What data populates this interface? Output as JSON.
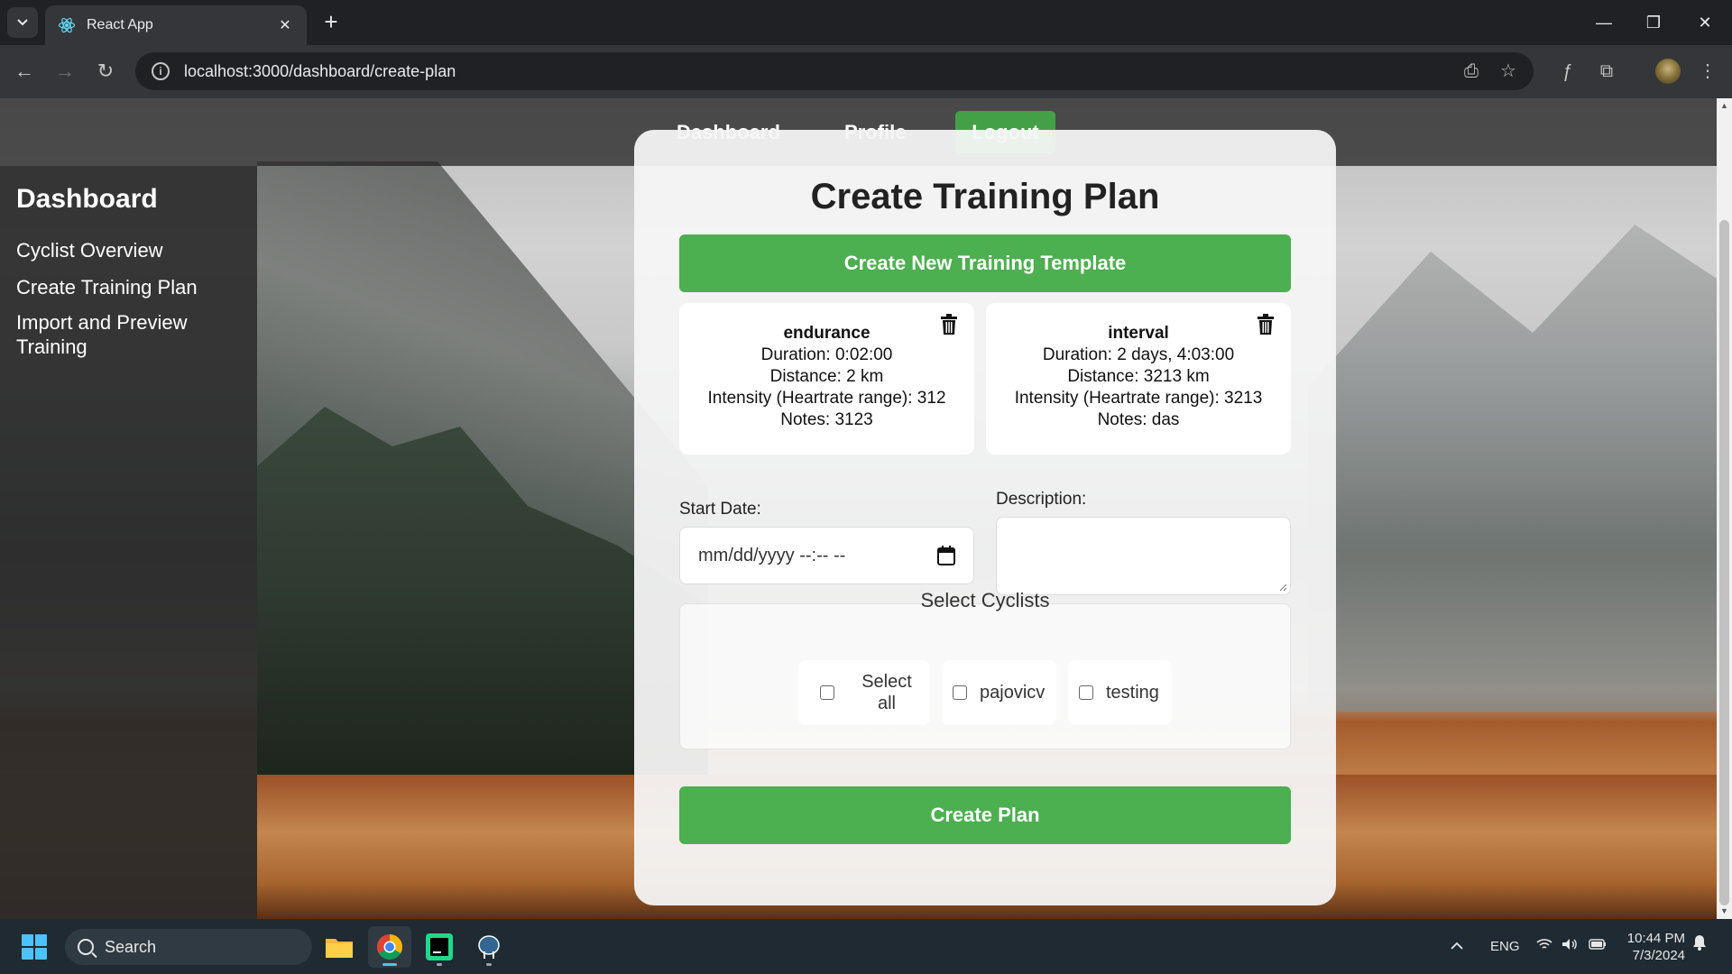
{
  "browser": {
    "tab_title": "React App",
    "url": "localhost:3000/dashboard/create-plan"
  },
  "nav": {
    "dashboard": "Dashboard",
    "profile": "Profile",
    "logout": "Logout"
  },
  "sidebar": {
    "title": "Dashboard",
    "items": [
      {
        "label": "Cyclist Overview"
      },
      {
        "label": "Create Training Plan"
      },
      {
        "label": "Import and Preview Training"
      }
    ]
  },
  "form": {
    "title": "Create Training Plan",
    "create_template_label": "Create New Training Template",
    "templates": [
      {
        "name": "endurance",
        "duration": "Duration: 0:02:00",
        "distance": "Distance: 2 km",
        "intensity": "Intensity (Heartrate range): 312",
        "notes": "Notes: 3123"
      },
      {
        "name": "interval",
        "duration": "Duration: 2 days, 4:03:00",
        "distance": "Distance: 3213 km",
        "intensity": "Intensity (Heartrate range): 3213",
        "notes": "Notes: das"
      }
    ],
    "start_date_label": "Start Date:",
    "start_date_placeholder": "mm/dd/yyyy --:-- --",
    "description_label": "Description:",
    "select_cyclists_label": "Select Cyclists",
    "cyclists": [
      {
        "label": "Select all"
      },
      {
        "label": "pajovicv"
      },
      {
        "label": "testing"
      }
    ],
    "submit_label": "Create Plan"
  },
  "taskbar": {
    "search_label": "Search",
    "language": "ENG",
    "time": "10:44 PM",
    "date": "7/3/2024"
  },
  "colors": {
    "accent_green": "#4caf50",
    "logout_green": "#43a047",
    "browser_dark": "#202124"
  }
}
